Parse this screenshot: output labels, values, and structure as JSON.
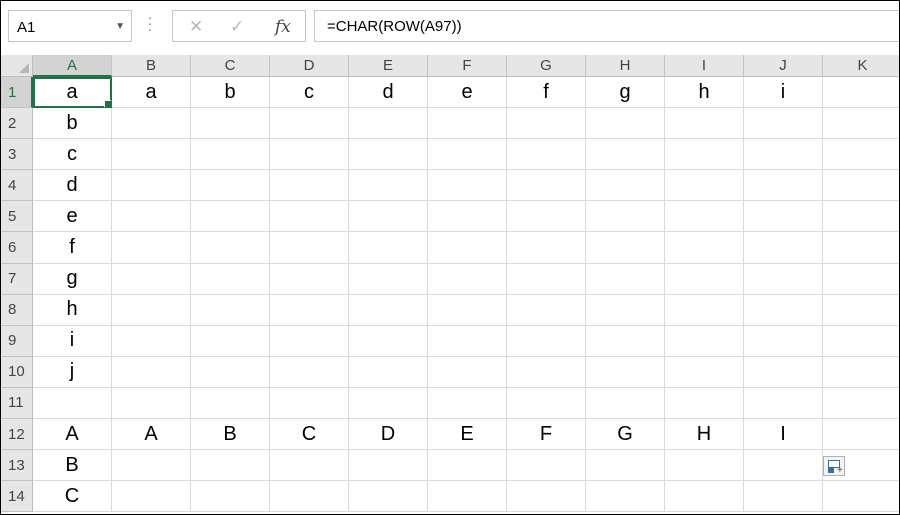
{
  "formula_bar": {
    "name_box": "A1",
    "formula": "=CHAR(ROW(A97))",
    "fx_label": "fx"
  },
  "columns": [
    "A",
    "B",
    "C",
    "D",
    "E",
    "F",
    "G",
    "H",
    "I",
    "J",
    "K"
  ],
  "rows": [
    {
      "num": "1",
      "cells": [
        "a",
        "a",
        "b",
        "c",
        "d",
        "e",
        "f",
        "g",
        "h",
        "i",
        ""
      ]
    },
    {
      "num": "2",
      "cells": [
        "b",
        "",
        "",
        "",
        "",
        "",
        "",
        "",
        "",
        "",
        ""
      ]
    },
    {
      "num": "3",
      "cells": [
        "c",
        "",
        "",
        "",
        "",
        "",
        "",
        "",
        "",
        "",
        ""
      ]
    },
    {
      "num": "4",
      "cells": [
        "d",
        "",
        "",
        "",
        "",
        "",
        "",
        "",
        "",
        "",
        ""
      ]
    },
    {
      "num": "5",
      "cells": [
        "e",
        "",
        "",
        "",
        "",
        "",
        "",
        "",
        "",
        "",
        ""
      ]
    },
    {
      "num": "6",
      "cells": [
        "f",
        "",
        "",
        "",
        "",
        "",
        "",
        "",
        "",
        "",
        ""
      ]
    },
    {
      "num": "7",
      "cells": [
        "g",
        "",
        "",
        "",
        "",
        "",
        "",
        "",
        "",
        "",
        ""
      ]
    },
    {
      "num": "8",
      "cells": [
        "h",
        "",
        "",
        "",
        "",
        "",
        "",
        "",
        "",
        "",
        ""
      ]
    },
    {
      "num": "9",
      "cells": [
        "i",
        "",
        "",
        "",
        "",
        "",
        "",
        "",
        "",
        "",
        ""
      ]
    },
    {
      "num": "10",
      "cells": [
        "j",
        "",
        "",
        "",
        "",
        "",
        "",
        "",
        "",
        "",
        ""
      ]
    },
    {
      "num": "11",
      "cells": [
        "",
        "",
        "",
        "",
        "",
        "",
        "",
        "",
        "",
        "",
        ""
      ]
    },
    {
      "num": "12",
      "cells": [
        "A",
        "A",
        "B",
        "C",
        "D",
        "E",
        "F",
        "G",
        "H",
        "I",
        ""
      ]
    },
    {
      "num": "13",
      "cells": [
        "B",
        "",
        "",
        "",
        "",
        "",
        "",
        "",
        "",
        "",
        ""
      ]
    },
    {
      "num": "14",
      "cells": [
        "C",
        "",
        "",
        "",
        "",
        "",
        "",
        "",
        "",
        "",
        ""
      ]
    }
  ],
  "selection": {
    "active_cell": "A1",
    "column": "A",
    "row": "1"
  },
  "colors": {
    "accent": "#217346",
    "header_bg": "#e6e6e6",
    "gridline": "#dadada"
  }
}
